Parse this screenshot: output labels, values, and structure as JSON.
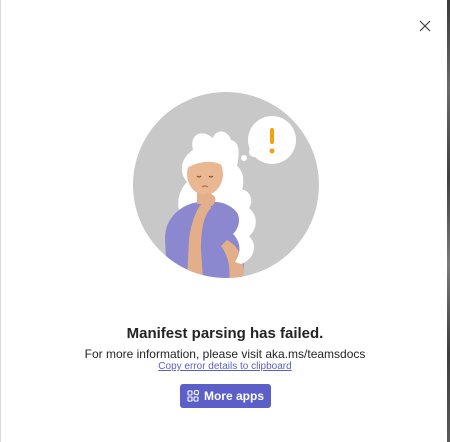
{
  "dialog": {
    "title": "Manifest parsing has failed.",
    "description": "For more information, please visit aka.ms/teamsdocs",
    "copy_link": "Copy error details to clipboard",
    "button_label": "More apps",
    "icons": {
      "close": "close-icon",
      "apps": "apps-icon",
      "alert": "exclamation-icon"
    }
  },
  "colors": {
    "accent": "#5b5fc7",
    "alert": "#f0a30a",
    "circle": "#c8c8c8",
    "text": "#242424"
  }
}
